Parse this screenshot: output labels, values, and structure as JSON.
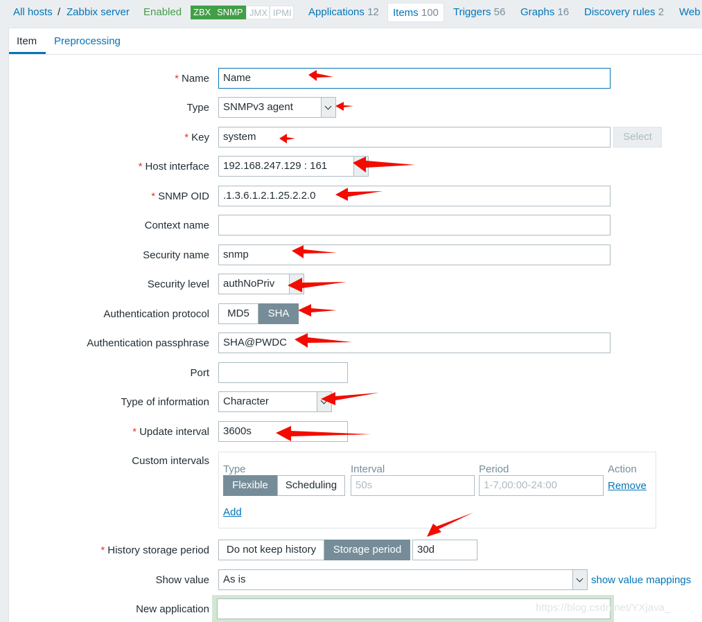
{
  "nav": {
    "all_hosts": "All hosts",
    "separator": "/",
    "host": "Zabbix server",
    "status": "Enabled",
    "availability": [
      {
        "label": "ZBX",
        "state": "on"
      },
      {
        "label": "SNMP",
        "state": "on"
      },
      {
        "label": "JMX",
        "state": "off"
      },
      {
        "label": "IPMI",
        "state": "off"
      }
    ],
    "tabs": [
      {
        "label": "Applications",
        "count": "12"
      },
      {
        "label": "Items",
        "count": "100"
      },
      {
        "label": "Triggers",
        "count": "56"
      },
      {
        "label": "Graphs",
        "count": "16"
      },
      {
        "label": "Discovery rules",
        "count": "2"
      },
      {
        "label": "Web",
        "count": ""
      }
    ]
  },
  "form_tabs": {
    "item": "Item",
    "preprocessing": "Preprocessing"
  },
  "required_mark": "*",
  "fields": {
    "name": {
      "label": "Name",
      "value": "Name"
    },
    "type": {
      "label": "Type",
      "value": "SNMPv3 agent"
    },
    "key": {
      "label": "Key",
      "value": "system",
      "button": "Select"
    },
    "host_interface": {
      "label": "Host interface",
      "value": "192.168.247.129 : 161"
    },
    "snmp_oid": {
      "label": "SNMP OID",
      "value": ".1.3.6.1.2.1.25.2.2.0"
    },
    "context_name": {
      "label": "Context name",
      "value": ""
    },
    "security_name": {
      "label": "Security name",
      "value": "snmp"
    },
    "security_level": {
      "label": "Security level",
      "value": "authNoPriv"
    },
    "auth_protocol": {
      "label": "Authentication protocol",
      "options": [
        "MD5",
        "SHA"
      ],
      "selected": "SHA"
    },
    "auth_passphrase": {
      "label": "Authentication passphrase",
      "value": "SHA@PWDC"
    },
    "port": {
      "label": "Port",
      "value": ""
    },
    "type_of_information": {
      "label": "Type of information",
      "value": "Character"
    },
    "update_interval": {
      "label": "Update interval",
      "value": "3600s"
    },
    "custom_intervals": {
      "label": "Custom intervals",
      "headers": [
        "Type",
        "Interval",
        "Period",
        "Action"
      ],
      "row": {
        "types": [
          "Flexible",
          "Scheduling"
        ],
        "selected": "Flexible",
        "interval_placeholder": "50s",
        "period_placeholder": "1-7,00:00-24:00",
        "action": "Remove"
      },
      "add": "Add"
    },
    "history_storage": {
      "label": "History storage period",
      "options": [
        "Do not keep history",
        "Storage period"
      ],
      "selected": "Storage period",
      "value": "30d"
    },
    "show_value": {
      "label": "Show value",
      "value": "As is",
      "link": "show value mappings"
    },
    "new_application": {
      "label": "New application",
      "value": ""
    }
  },
  "watermark": "https://blog.csdn.net/YXjava_",
  "colors": {
    "link": "#0275b8",
    "enabled": "#429e47",
    "required": "#e33734",
    "annotation_arrow": "#f20c00"
  }
}
